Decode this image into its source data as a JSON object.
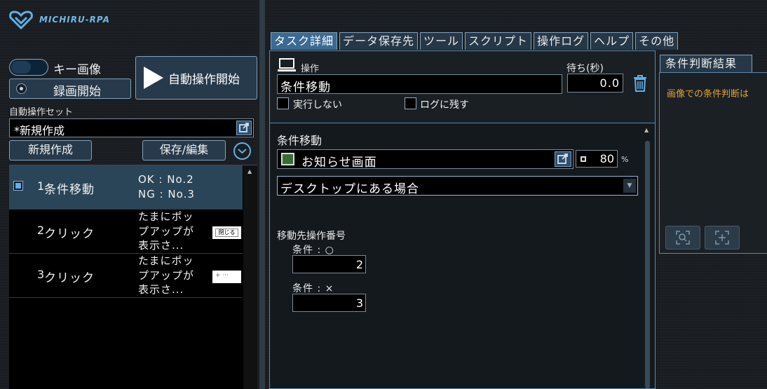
{
  "app": {
    "logo_text": "MICHIRU-RPA"
  },
  "left": {
    "toggle_label": "キー画像",
    "record_label": "録画開始",
    "start_label": "自動操作開始",
    "set_label": "自動操作セット",
    "set_value": "*新規作成",
    "new_label": "新規作成",
    "save_label": "保存/編集",
    "tasks": [
      {
        "num": "1",
        "name": "条件移動",
        "desc_line1": "OK : No.2",
        "desc_line2": "NG : No.3"
      },
      {
        "num": "2",
        "name": "クリック",
        "desc_line1": "たまにポッ",
        "desc_line2": "プアップが",
        "desc_line3": "表示さ...",
        "thumb": "閉じる"
      },
      {
        "num": "3",
        "name": "クリック",
        "desc_line1": "たまにポッ",
        "desc_line2": "プアップが",
        "desc_line3": "表示さ...",
        "thumb": "+ ···"
      }
    ]
  },
  "tabs": [
    "タスク詳細",
    "データ保存先",
    "ツール",
    "スクリプト",
    "操作ログ",
    "ヘルプ",
    "その他"
  ],
  "detail": {
    "op_label": "操作",
    "op_value": "条件移動",
    "wait_label": "待ち(秒)",
    "wait_value": "0.0",
    "no_exec_label": "実行しない",
    "keep_log_label": "ログに残す",
    "section_title": "条件移動",
    "image_name": "お知らせ画面",
    "threshold": "80",
    "threshold_unit": "%",
    "location_option": "デスクトップにある場合",
    "dest_label": "移動先操作番号",
    "cond_ok_label": "条件 : ○",
    "cond_ok_value": "2",
    "cond_ng_label": "条件 : ×",
    "cond_ng_value": "3"
  },
  "result": {
    "tab_label": "条件判断結果",
    "text": "画像での条件判断は"
  },
  "colors": {
    "accent": "#5fb0e6",
    "active_tab": "#3b6a92",
    "warn_text": "#e3a23c"
  }
}
